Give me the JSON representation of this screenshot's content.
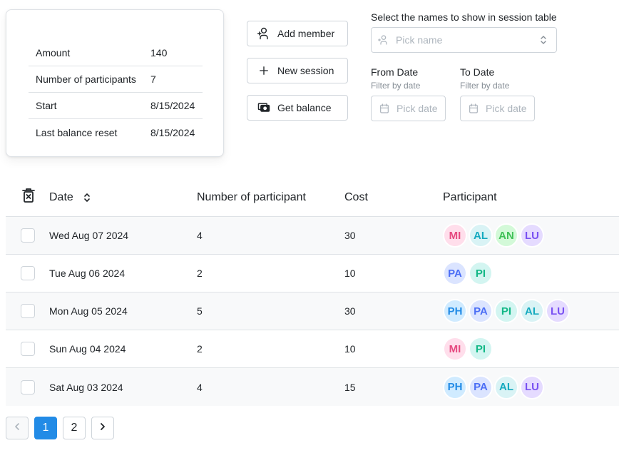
{
  "summary": {
    "rows": [
      {
        "label": "Amount",
        "value": "140"
      },
      {
        "label": "Number of participants",
        "value": "7"
      },
      {
        "label": "Start",
        "value": "8/15/2024"
      },
      {
        "label": "Last balance reset",
        "value": "8/15/2024"
      }
    ]
  },
  "actions": {
    "add_member": "Add member",
    "new_session": "New session",
    "get_balance": "Get balance"
  },
  "filters": {
    "names_label": "Select the names to show in session table",
    "names_placeholder": "Pick name",
    "from_label": "From Date",
    "from_desc": "Filter by date",
    "from_placeholder": "Pick date",
    "to_label": "To Date",
    "to_desc": "Filter by date",
    "to_placeholder": "Pick date"
  },
  "table": {
    "headers": {
      "date": "Date",
      "count": "Number of participant",
      "cost": "Cost",
      "participant": "Participant"
    },
    "rows": [
      {
        "date": "Wed Aug 07 2024",
        "count": "4",
        "cost": "30",
        "participants": [
          "MI",
          "AL",
          "AN",
          "LU"
        ]
      },
      {
        "date": "Tue Aug 06 2024",
        "count": "2",
        "cost": "10",
        "participants": [
          "PA",
          "PI"
        ]
      },
      {
        "date": "Mon Aug 05 2024",
        "count": "5",
        "cost": "30",
        "participants": [
          "PH",
          "PA",
          "PI",
          "AL",
          "LU"
        ]
      },
      {
        "date": "Sun Aug 04 2024",
        "count": "2",
        "cost": "10",
        "participants": [
          "MI",
          "PI"
        ]
      },
      {
        "date": "Sat Aug 03 2024",
        "count": "4",
        "cost": "15",
        "participants": [
          "PH",
          "PA",
          "AL",
          "LU"
        ]
      }
    ]
  },
  "avatar_colors": {
    "MI": {
      "bg": "#ffdeeb",
      "fg": "#e64980"
    },
    "AL": {
      "bg": "#d9f3f5",
      "fg": "#15aabf"
    },
    "AN": {
      "bg": "#d3f9d8",
      "fg": "#40c057"
    },
    "LU": {
      "bg": "#e5dbff",
      "fg": "#7950f2"
    },
    "PA": {
      "bg": "#dbe4ff",
      "fg": "#4c6ef5"
    },
    "PI": {
      "bg": "#d3f5f1",
      "fg": "#12b886"
    },
    "PH": {
      "bg": "#d0ebff",
      "fg": "#228be6"
    }
  },
  "pagination": {
    "pages": [
      "1",
      "2"
    ],
    "active": "1"
  }
}
